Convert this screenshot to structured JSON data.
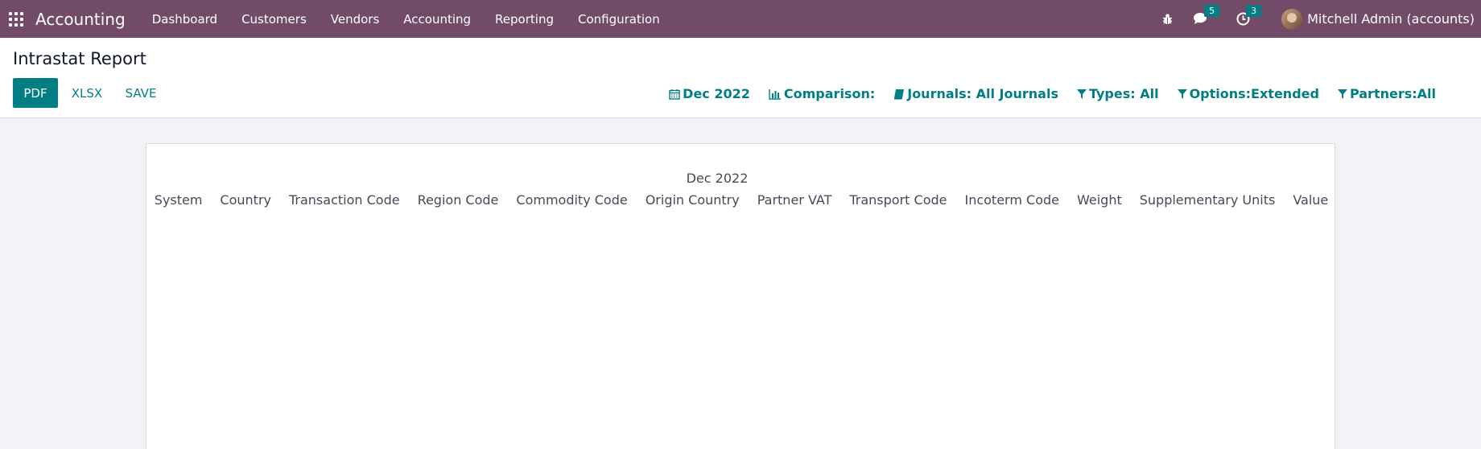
{
  "navbar": {
    "app_name": "Accounting",
    "menu": [
      "Dashboard",
      "Customers",
      "Vendors",
      "Accounting",
      "Reporting",
      "Configuration"
    ],
    "messages_count": "5",
    "activities_count": "3",
    "user": "Mitchell Admin (accounts)",
    "bar_color": "#714b67"
  },
  "page": {
    "title": "Intrastat Report",
    "buttons": {
      "pdf": "PDF",
      "xlsx": "XLSX",
      "save": "SAVE"
    },
    "filters": {
      "date": "Dec 2022",
      "comparison": "Comparison:",
      "journals": "Journals: All Journals",
      "types": "Types: All",
      "options": "Options:Extended",
      "partners": "Partners:All"
    },
    "accent_color": "#017e84"
  },
  "report": {
    "period": "Dec 2022",
    "columns": [
      "System",
      "Country",
      "Transaction Code",
      "Region Code",
      "Commodity Code",
      "Origin Country",
      "Partner VAT",
      "Transport Code",
      "Incoterm Code",
      "Weight",
      "Supplementary Units",
      "Value"
    ]
  }
}
